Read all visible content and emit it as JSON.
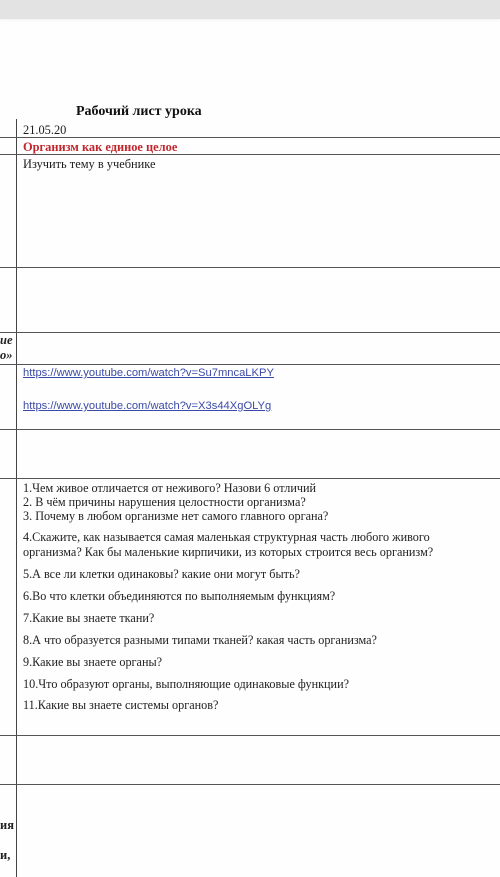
{
  "document": {
    "title": "Рабочий лист урока",
    "date": "21.05.20",
    "topic": "Организм как единое целое",
    "task": "Изучить тему в учебнике",
    "left_column_fragments": [
      "ие",
      "о»",
      "ия",
      "и,"
    ],
    "links": [
      "https://www.youtube.com/watch?v=Su7mncaLKPY",
      "https://www.youtube.com/watch?v=X3s44XgOLYg"
    ],
    "questions": [
      "1.Чем живое отличается от неживого? Назови 6 отличий",
      "2. В чём причины нарушения целостности организма?",
      "3. Почему в любом организме нет самого главного органа?",
      "4.Скажите, как называется самая маленькая структурная часть любого живого",
      "организма? Как бы маленькие кирпичики, из которых строится весь организм?",
      "5.А все ли клетки одинаковы? какие они могут быть?",
      "6.Во что клетки объединяются по выполняемым функциям?",
      "7.Какие вы знаете ткани?",
      "8.А что образуется разными типами тканей? какая часть организма?",
      "9.Какие вы знаете органы?",
      "10.Что образуют органы, выполняющие одинаковые функции?",
      "11.Какие вы знаете системы органов?"
    ]
  }
}
